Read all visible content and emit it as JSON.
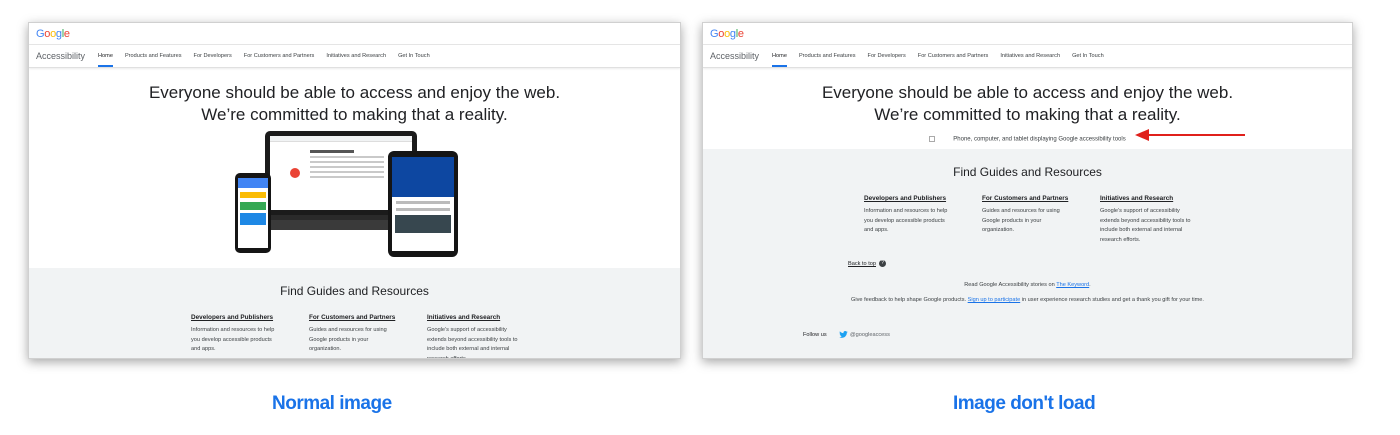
{
  "logo": "Google",
  "nav": {
    "site_name": "Accessibility",
    "tabs": [
      "Home",
      "Products and Features",
      "For Developers",
      "For Customers and Partners",
      "Initiatives and Research",
      "Get In Touch"
    ]
  },
  "hero": {
    "line1": "Everyone should be able to access and enjoy the web.",
    "line2": "We’re committed to making that a reality."
  },
  "broken_image_alt": "Phone, computer, and tablet displaying Google accessibility tools",
  "guides": {
    "heading": "Find Guides and Resources",
    "columns": [
      {
        "title": "Developers and Publishers",
        "desc": "Information and resources to help you develop accessible products and apps."
      },
      {
        "title": "For Customers and Partners",
        "desc": "Guides and resources for using Google products in your organization."
      },
      {
        "title": "Initiatives and Research",
        "desc": "Google’s support of accessibility extends beyond accessibility tools to include both external and internal research efforts."
      }
    ]
  },
  "back_to_top": "Back to top",
  "footer": {
    "stories_prefix": "Read Google Accessibility stories on ",
    "stories_link": "The Keyword",
    "stories_suffix": ".",
    "feedback_prefix": "Give feedback to help shape Google products. ",
    "feedback_link": "Sign up to participate",
    "feedback_suffix": " in user experience research studies and get a thank you gift for your time.",
    "follow_label": "Follow us",
    "twitter_handle": "@googleaccess"
  },
  "captions": {
    "left": "Normal image",
    "right": "Image don't load"
  },
  "colors": {
    "accent": "#1a73e8",
    "arrow": "#e0201b",
    "section_bg": "#f1f3f4"
  }
}
